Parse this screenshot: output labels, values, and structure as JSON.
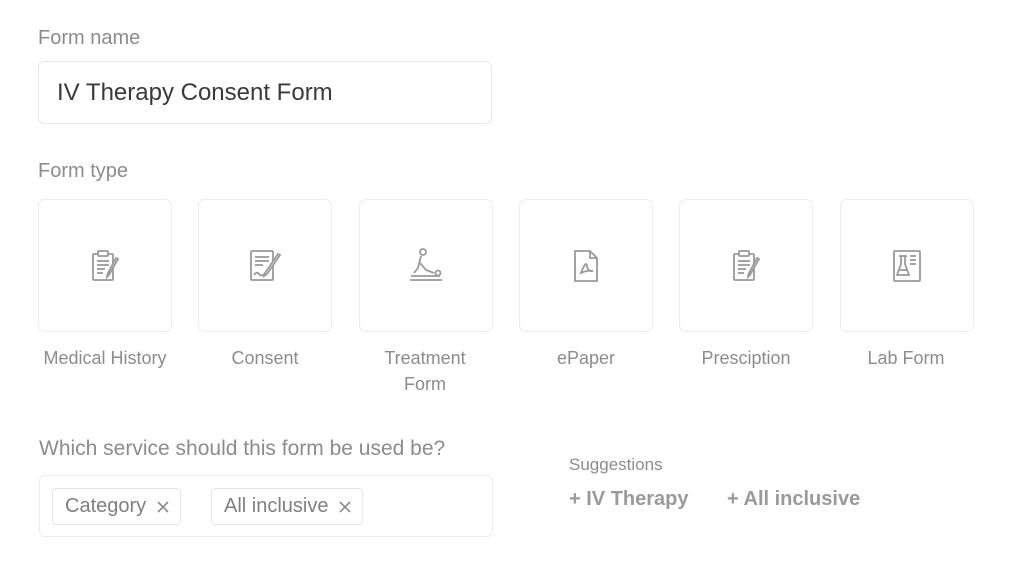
{
  "form_name": {
    "label": "Form name",
    "value": "IV Therapy Consent Form"
  },
  "form_type": {
    "label": "Form type",
    "options": [
      {
        "label": "Medical History",
        "icon": "clipboard-pen-icon"
      },
      {
        "label": "Consent",
        "icon": "document-sign-icon"
      },
      {
        "label": "Treatment Form",
        "icon": "treatment-person-icon"
      },
      {
        "label": "ePaper",
        "icon": "pdf-file-icon"
      },
      {
        "label": "Presciption",
        "icon": "clipboard-pen-icon"
      },
      {
        "label": "Lab Form",
        "icon": "lab-flask-icon"
      }
    ]
  },
  "service": {
    "label": "Which service should this form be used be?",
    "chips": [
      "Category",
      "All inclusive"
    ]
  },
  "suggestions": {
    "label": "Suggestions",
    "items": [
      "+ IV Therapy",
      "+ All inclusive"
    ]
  },
  "colors": {
    "text": "#8c8c8c",
    "input_text": "#3a3a3a",
    "border": "#ececec",
    "icon": "#9a9a9a"
  }
}
